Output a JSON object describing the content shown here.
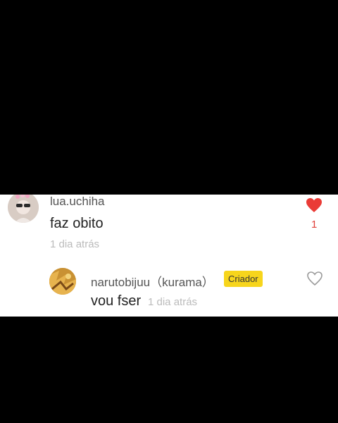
{
  "comment": {
    "username": "lua.uchiha",
    "text": "faz obito",
    "time": "1 dia atrás",
    "like_count": "1",
    "liked": true,
    "heart_color": "#ea3b36"
  },
  "reply": {
    "username": "narutobijuu（kurama）",
    "badge": "Criador",
    "badge_color": "#f7d51c",
    "text": "vou fser",
    "time": "1 dia atrás",
    "liked": false
  },
  "icons": {
    "comment_like": "heart-filled-icon",
    "reply_like": "heart-outline-icon"
  }
}
